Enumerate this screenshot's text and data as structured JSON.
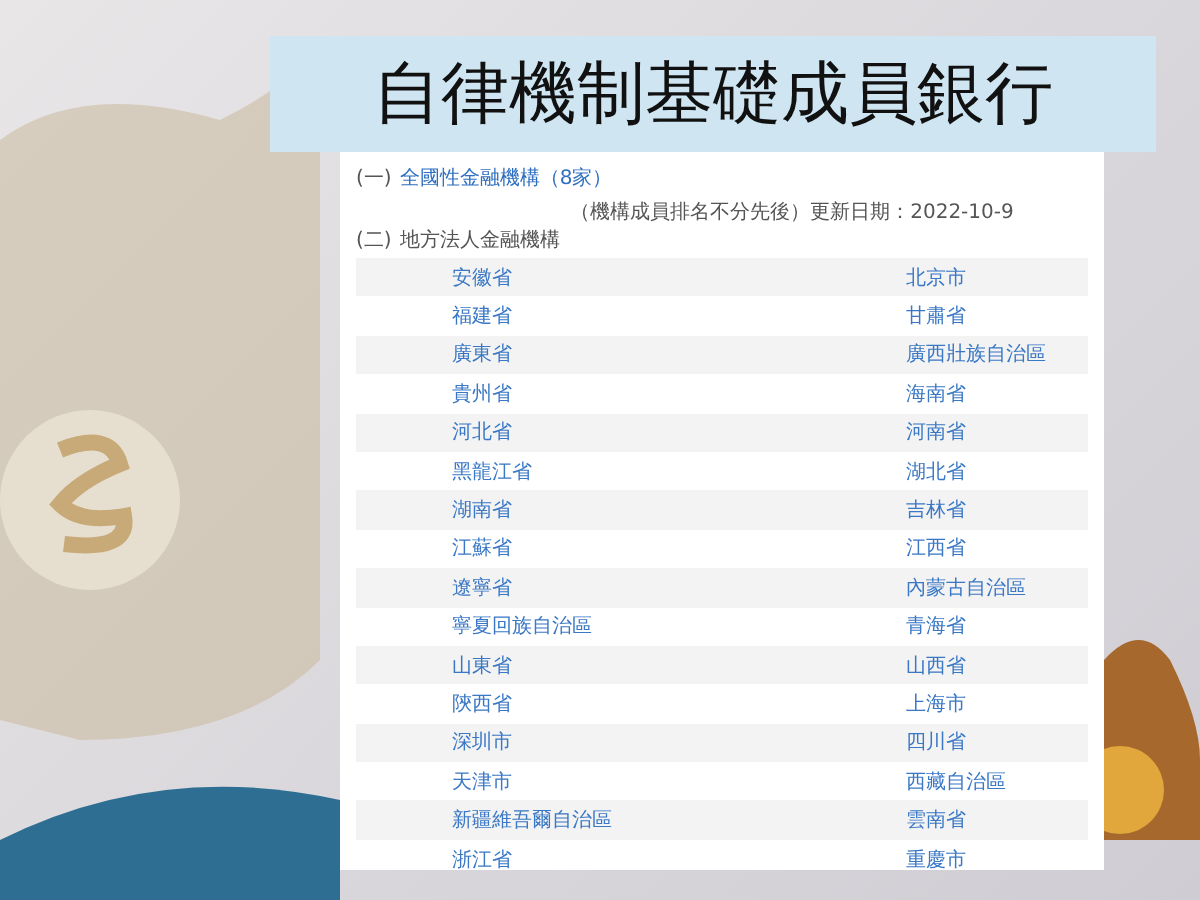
{
  "title": "自律機制基礎成員銀行",
  "section_1": {
    "marker": "(一)",
    "link": "全國性金融機構（8家）"
  },
  "note": "（機構成員排名不分先後）更新日期：2022-10-9",
  "section_2": {
    "marker": "(二)",
    "label": "地方法人金融機構"
  },
  "rows": [
    [
      "安徽省",
      "北京市"
    ],
    [
      "福建省",
      "甘肅省"
    ],
    [
      "廣東省",
      "廣西壯族自治區"
    ],
    [
      "貴州省",
      "海南省"
    ],
    [
      "河北省",
      "河南省"
    ],
    [
      "黑龍江省",
      "湖北省"
    ],
    [
      "湖南省",
      "吉林省"
    ],
    [
      "江蘇省",
      "江西省"
    ],
    [
      "遼寧省",
      "內蒙古自治區"
    ],
    [
      "寧夏回族自治區",
      "青海省"
    ],
    [
      "山東省",
      "山西省"
    ],
    [
      "陝西省",
      "上海市"
    ],
    [
      "深圳市",
      "四川省"
    ],
    [
      "天津市",
      "西藏自治區"
    ],
    [
      "新疆維吾爾自治區",
      "雲南省"
    ],
    [
      "浙江省",
      "重慶市"
    ]
  ]
}
